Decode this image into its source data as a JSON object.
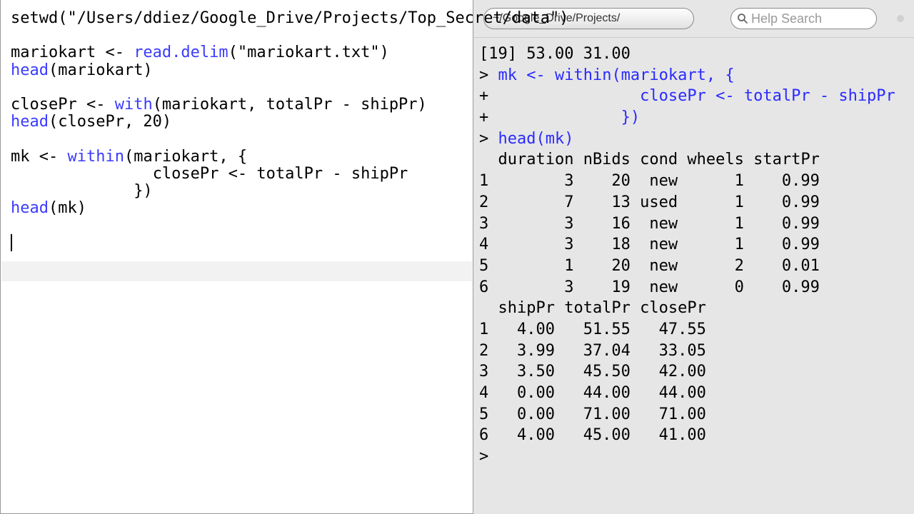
{
  "toolbar": {
    "path_text": "~/Google_Drive/Projects/",
    "search_placeholder": "Help Search"
  },
  "editor": {
    "line1": "setwd(\"/Users/ddiez/Google_Drive/Projects/Top_Secret/data\")",
    "line2": "",
    "line3a": "mariokart <- ",
    "line3b": "read.delim",
    "line3c": "(\"mariokart.txt\")",
    "line4a": "head",
    "line4b": "(mariokart)",
    "line5": "",
    "line6a": "closePr <- ",
    "line6b": "with",
    "line6c": "(mariokart, totalPr - shipPr)",
    "line7a": "head",
    "line7b": "(closePr, 20)",
    "line8": "",
    "line9a": "mk <- ",
    "line9b": "within",
    "line9c": "(mariokart, {",
    "line10": "               closePr <- totalPr - shipPr",
    "line11": "             })",
    "line12a": "head",
    "line12b": "(mk)"
  },
  "console": {
    "l0": "[19] 53.00 31.00",
    "l1a": "> ",
    "l1b": "mk <- within(mariokart, {",
    "l2a": "+ ",
    "l2b": "               closePr <- totalPr - shipPr",
    "l3a": "+ ",
    "l3b": "             })",
    "l4a": "> ",
    "l4b": "head(mk)",
    "hdr1": "  duration nBids cond wheels startPr",
    "r1_1": "1        3    20  new      1    0.99",
    "r1_2": "2        7    13 used      1    0.99",
    "r1_3": "3        3    16  new      1    0.99",
    "r1_4": "4        3    18  new      1    0.99",
    "r1_5": "5        1    20  new      2    0.01",
    "r1_6": "6        3    19  new      0    0.99",
    "hdr2": "  shipPr totalPr closePr",
    "r2_1": "1   4.00   51.55   47.55",
    "r2_2": "2   3.99   37.04   33.05",
    "r2_3": "3   3.50   45.50   42.00",
    "r2_4": "4   0.00   44.00   44.00",
    "r2_5": "5   0.00   71.00   71.00",
    "r2_6": "6   4.00   45.00   41.00",
    "prompt": "> "
  },
  "chart_data": {
    "type": "table",
    "title": "head(mk)",
    "columns": [
      "duration",
      "nBids",
      "cond",
      "wheels",
      "startPr",
      "shipPr",
      "totalPr",
      "closePr"
    ],
    "rows": [
      {
        "duration": 3,
        "nBids": 20,
        "cond": "new",
        "wheels": 1,
        "startPr": 0.99,
        "shipPr": 4.0,
        "totalPr": 51.55,
        "closePr": 47.55
      },
      {
        "duration": 7,
        "nBids": 13,
        "cond": "used",
        "wheels": 1,
        "startPr": 0.99,
        "shipPr": 3.99,
        "totalPr": 37.04,
        "closePr": 33.05
      },
      {
        "duration": 3,
        "nBids": 16,
        "cond": "new",
        "wheels": 1,
        "startPr": 0.99,
        "shipPr": 3.5,
        "totalPr": 45.5,
        "closePr": 42.0
      },
      {
        "duration": 3,
        "nBids": 18,
        "cond": "new",
        "wheels": 1,
        "startPr": 0.99,
        "shipPr": 0.0,
        "totalPr": 44.0,
        "closePr": 44.0
      },
      {
        "duration": 1,
        "nBids": 20,
        "cond": "new",
        "wheels": 2,
        "startPr": 0.01,
        "shipPr": 0.0,
        "totalPr": 71.0,
        "closePr": 71.0
      },
      {
        "duration": 3,
        "nBids": 19,
        "cond": "new",
        "wheels": 0,
        "startPr": 0.99,
        "shipPr": 4.0,
        "totalPr": 45.0,
        "closePr": 41.0
      }
    ],
    "extra_vector": {
      "index": 19,
      "values": [
        53.0,
        31.0
      ]
    }
  }
}
